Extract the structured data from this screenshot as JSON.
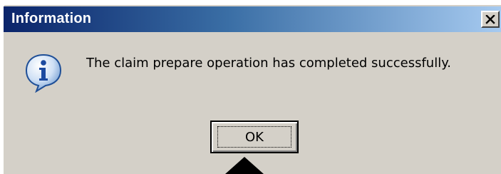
{
  "dialog": {
    "title": "Information",
    "message": "The claim prepare operation has completed successfully.",
    "icon": "information-icon",
    "ok_label": "OK",
    "close_icon": "close-icon"
  },
  "colors": {
    "face": "#d4d0c8",
    "title_start": "#0a246a",
    "title_end": "#a6caf0"
  },
  "overlay": {
    "pointer": "up-arrow-icon"
  }
}
